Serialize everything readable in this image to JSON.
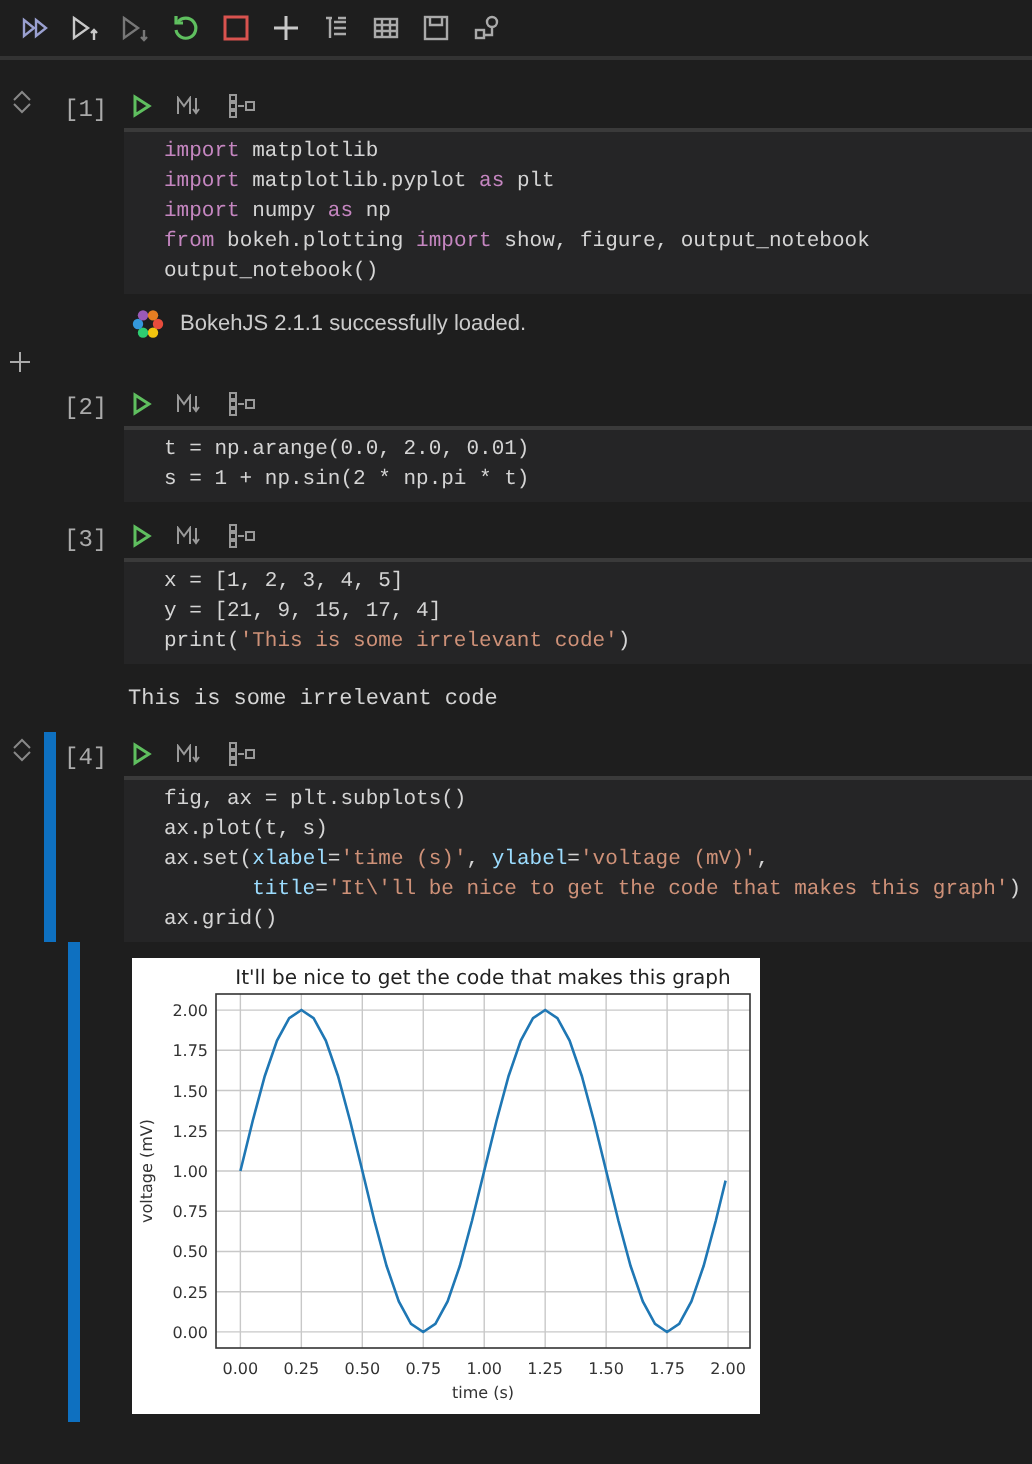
{
  "toolbar": {
    "buttons": [
      {
        "kind": "run-all"
      },
      {
        "kind": "run-above"
      },
      {
        "kind": "run-below"
      },
      {
        "kind": "restart"
      },
      {
        "kind": "stop"
      },
      {
        "kind": "add"
      },
      {
        "kind": "export"
      },
      {
        "kind": "variables"
      },
      {
        "kind": "save"
      },
      {
        "kind": "debug"
      }
    ]
  },
  "cells": [
    {
      "prompt": "[1]",
      "selected": false,
      "hovered": true,
      "code": [
        [
          {
            "text": "import",
            "kind": "keyword"
          },
          {
            "text": " matplotlib",
            "kind": "plain"
          }
        ],
        [
          {
            "text": "import",
            "kind": "keyword"
          },
          {
            "text": " matplotlib.pyplot ",
            "kind": "plain"
          },
          {
            "text": "as",
            "kind": "keyword"
          },
          {
            "text": " plt",
            "kind": "plain"
          }
        ],
        [
          {
            "text": "import",
            "kind": "keyword"
          },
          {
            "text": " numpy ",
            "kind": "plain"
          },
          {
            "text": "as",
            "kind": "keyword"
          },
          {
            "text": " np",
            "kind": "plain"
          }
        ],
        [
          {
            "text": "from",
            "kind": "keyword"
          },
          {
            "text": " bokeh.plotting ",
            "kind": "plain"
          },
          {
            "text": "import",
            "kind": "keyword"
          },
          {
            "text": " show, figure, output_notebook",
            "kind": "plain"
          }
        ],
        [
          {
            "text": "output_notebook()",
            "kind": "plain"
          }
        ]
      ],
      "output": {
        "kind": "bokeh",
        "text": "BokehJS 2.1.1 successfully loaded."
      },
      "add_after": true
    },
    {
      "prompt": "[2]",
      "selected": false,
      "hovered": false,
      "code": [
        [
          {
            "text": "t = np.arange(0.0, 2.0, 0.01)",
            "kind": "plain"
          }
        ],
        [
          {
            "text": "s = 1 + np.sin(2 * np.pi * t)",
            "kind": "plain"
          }
        ]
      ]
    },
    {
      "prompt": "[3]",
      "selected": false,
      "hovered": false,
      "code": [
        [
          {
            "text": "x = [1, 2, 3, 4, 5]",
            "kind": "plain"
          }
        ],
        [
          {
            "text": "y = [21, 9, 15, 17, 4]",
            "kind": "plain"
          }
        ],
        [
          {
            "text": "print(",
            "kind": "plain"
          },
          {
            "text": "'This is some irrelevant code'",
            "kind": "string"
          },
          {
            "text": ")",
            "kind": "plain"
          }
        ]
      ],
      "output": {
        "kind": "text",
        "text": "This is some irrelevant code"
      }
    },
    {
      "prompt": "[4]",
      "selected": true,
      "hovered": false,
      "code": [
        [
          {
            "text": "fig, ax = plt.subplots()",
            "kind": "plain"
          }
        ],
        [
          {
            "text": "ax.plot(t, s)",
            "kind": "plain"
          }
        ],
        [
          {
            "text": "ax.set(",
            "kind": "plain"
          },
          {
            "text": "xlabel",
            "kind": "param"
          },
          {
            "text": "=",
            "kind": "plain"
          },
          {
            "text": "'time (s)'",
            "kind": "string"
          },
          {
            "text": ", ",
            "kind": "plain"
          },
          {
            "text": "ylabel",
            "kind": "param"
          },
          {
            "text": "=",
            "kind": "plain"
          },
          {
            "text": "'voltage (mV)'",
            "kind": "string"
          },
          {
            "text": ",",
            "kind": "plain"
          }
        ],
        [
          {
            "text": "       title",
            "kind": "param"
          },
          {
            "text": "=",
            "kind": "plain"
          },
          {
            "text": "'It\\'ll be nice to get the code that makes this graph'",
            "kind": "string"
          },
          {
            "text": ")",
            "kind": "plain"
          }
        ],
        [
          {
            "text": "ax.grid()",
            "kind": "plain"
          }
        ]
      ],
      "output": {
        "kind": "chart",
        "chart_data": {
          "type": "line",
          "title": "It'll be nice to get the code that makes this graph",
          "xlabel": "time (s)",
          "ylabel": "voltage (mV)",
          "x": [
            0,
            0.05,
            0.1,
            0.15,
            0.2,
            0.25,
            0.3,
            0.35,
            0.4,
            0.45,
            0.5,
            0.55,
            0.6,
            0.65,
            0.7,
            0.75,
            0.8,
            0.85,
            0.9,
            0.95,
            1,
            1.05,
            1.1,
            1.15,
            1.2,
            1.25,
            1.3,
            1.35,
            1.4,
            1.45,
            1.5,
            1.55,
            1.6,
            1.65,
            1.7,
            1.75,
            1.8,
            1.85,
            1.9,
            1.95,
            1.99
          ],
          "series": [
            {
              "color": "#1f77b4",
              "values": [
                1,
                1.31,
                1.59,
                1.81,
                1.95,
                2,
                1.95,
                1.81,
                1.59,
                1.31,
                1,
                0.69,
                0.41,
                0.19,
                0.05,
                0,
                0.05,
                0.19,
                0.41,
                0.69,
                1,
                1.31,
                1.59,
                1.81,
                1.95,
                2,
                1.95,
                1.81,
                1.59,
                1.31,
                1,
                0.69,
                0.41,
                0.19,
                0.05,
                0,
                0.05,
                0.19,
                0.41,
                0.69,
                0.94
              ]
            }
          ],
          "grid": true,
          "xlim": [
            -0.1,
            2.09
          ],
          "ylim": [
            -0.1,
            2.1
          ],
          "xticks": [
            {
              "value": 0,
              "label": "0.00"
            },
            {
              "value": 0.25,
              "label": "0.25"
            },
            {
              "value": 0.5,
              "label": "0.50"
            },
            {
              "value": 0.75,
              "label": "0.75"
            },
            {
              "value": 1,
              "label": "1.00"
            },
            {
              "value": 1.25,
              "label": "1.25"
            },
            {
              "value": 1.5,
              "label": "1.50"
            },
            {
              "value": 1.75,
              "label": "1.75"
            },
            {
              "value": 2,
              "label": "2.00"
            }
          ],
          "yticks": [
            {
              "value": 0,
              "label": "0.00"
            },
            {
              "value": 0.25,
              "label": "0.25"
            },
            {
              "value": 0.5,
              "label": "0.50"
            },
            {
              "value": 0.75,
              "label": "0.75"
            },
            {
              "value": 1,
              "label": "1.00"
            },
            {
              "value": 1.25,
              "label": "1.25"
            },
            {
              "value": 1.5,
              "label": "1.50"
            },
            {
              "value": 1.75,
              "label": "1.75"
            },
            {
              "value": 2,
              "label": "2.00"
            }
          ]
        }
      }
    }
  ]
}
